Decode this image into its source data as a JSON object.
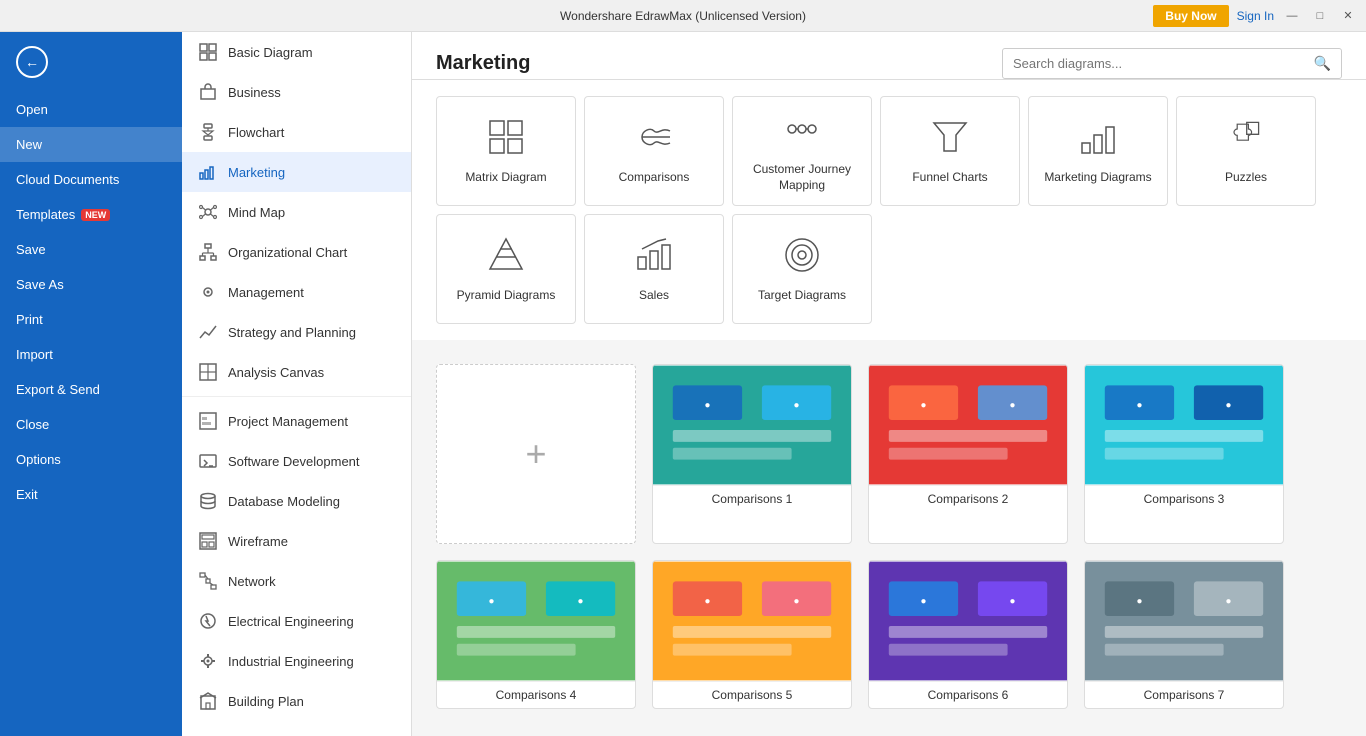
{
  "app": {
    "title": "Wondershare EdrawMax (Unlicensed Version)",
    "buy_now": "Buy Now",
    "sign_in": "Sign In"
  },
  "window_controls": {
    "minimize": "—",
    "maximize": "□",
    "close": "✕"
  },
  "sidebar": {
    "back_arrow": "←",
    "items": [
      {
        "id": "open",
        "label": "Open"
      },
      {
        "id": "new",
        "label": "New",
        "active": true
      },
      {
        "id": "cloud",
        "label": "Cloud Documents"
      },
      {
        "id": "templates",
        "label": "Templates",
        "badge": "NEW"
      },
      {
        "id": "save",
        "label": "Save"
      },
      {
        "id": "save-as",
        "label": "Save As"
      },
      {
        "id": "print",
        "label": "Print"
      },
      {
        "id": "import",
        "label": "Import"
      },
      {
        "id": "export",
        "label": "Export & Send"
      },
      {
        "id": "close",
        "label": "Close"
      },
      {
        "id": "options",
        "label": "Options"
      },
      {
        "id": "exit",
        "label": "Exit"
      }
    ]
  },
  "nav": {
    "items": [
      {
        "id": "basic-diagram",
        "label": "Basic Diagram",
        "icon": "⊞"
      },
      {
        "id": "business",
        "label": "Business",
        "icon": "💼"
      },
      {
        "id": "flowchart",
        "label": "Flowchart",
        "icon": "⬡"
      },
      {
        "id": "marketing",
        "label": "Marketing",
        "icon": "📊",
        "active": true
      },
      {
        "id": "mind-map",
        "label": "Mind Map",
        "icon": "⊛"
      },
      {
        "id": "org-chart",
        "label": "Organizational Chart",
        "icon": "⊟"
      },
      {
        "id": "management",
        "label": "Management",
        "icon": "⚙"
      },
      {
        "id": "strategy",
        "label": "Strategy and Planning",
        "icon": "📈"
      },
      {
        "id": "analysis",
        "label": "Analysis Canvas",
        "icon": "⊡"
      },
      {
        "id": "project-mgmt",
        "label": "Project Management",
        "icon": "▦"
      },
      {
        "id": "software-dev",
        "label": "Software Development",
        "icon": "⊞"
      },
      {
        "id": "database",
        "label": "Database Modeling",
        "icon": "⊕"
      },
      {
        "id": "wireframe",
        "label": "Wireframe",
        "icon": "⊡"
      },
      {
        "id": "network",
        "label": "Network",
        "icon": "🖥"
      },
      {
        "id": "electrical",
        "label": "Electrical Engineering",
        "icon": "⚡"
      },
      {
        "id": "industrial",
        "label": "Industrial Engineering",
        "icon": "⚙"
      },
      {
        "id": "building",
        "label": "Building Plan",
        "icon": "🏠"
      }
    ]
  },
  "content": {
    "title": "Marketing",
    "search_placeholder": "Search diagrams...",
    "categories": [
      {
        "id": "matrix",
        "label": "Matrix Diagram"
      },
      {
        "id": "comparisons",
        "label": "Comparisons"
      },
      {
        "id": "customer-journey",
        "label": "Customer Journey Mapping"
      },
      {
        "id": "funnel",
        "label": "Funnel Charts"
      },
      {
        "id": "marketing-diag",
        "label": "Marketing Diagrams"
      },
      {
        "id": "puzzles",
        "label": "Puzzles"
      },
      {
        "id": "pyramid",
        "label": "Pyramid Diagrams"
      },
      {
        "id": "sales",
        "label": "Sales"
      },
      {
        "id": "target",
        "label": "Target Diagrams"
      }
    ],
    "templates": [
      {
        "id": "add-new",
        "type": "add"
      },
      {
        "id": "comp1",
        "label": "Comparisons 1",
        "thumb": "comp1"
      },
      {
        "id": "comp2",
        "label": "Comparisons 2",
        "thumb": "comp2"
      },
      {
        "id": "comp3",
        "label": "Comparisons 3",
        "thumb": "comp3"
      },
      {
        "id": "comp4",
        "label": "Comparisons 4",
        "thumb": "comp4"
      },
      {
        "id": "comp5",
        "label": "Comparisons 5",
        "thumb": "comp5"
      },
      {
        "id": "comp6",
        "label": "Comparisons 6",
        "thumb": "comp6"
      },
      {
        "id": "comp7",
        "label": "Comparisons 7",
        "thumb": "comp7"
      }
    ]
  }
}
